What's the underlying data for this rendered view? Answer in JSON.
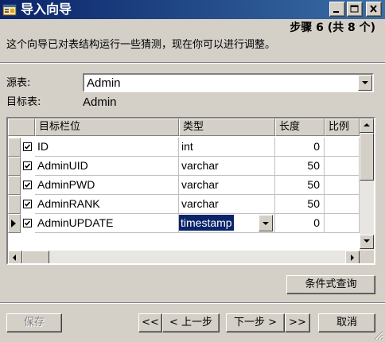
{
  "window": {
    "title": "导入向导",
    "icon": "wizard-app-icon",
    "controls": [
      "minimize-icon",
      "maximize-icon",
      "close-icon"
    ]
  },
  "header": {
    "step": "步骤 6 (共 8 个)",
    "description": "这个向导已对表结构运行一些猜测，现在你可以进行调整。"
  },
  "source": {
    "label": "源表:",
    "value": "Admin"
  },
  "target": {
    "label": "目标表:",
    "value": "Admin"
  },
  "grid": {
    "columns": [
      "目标栏位",
      "类型",
      "长度",
      "比例"
    ],
    "rows": [
      {
        "checked": true,
        "field": "ID",
        "type": "int",
        "length": "0",
        "scale": ""
      },
      {
        "checked": true,
        "field": "AdminUID",
        "type": "varchar",
        "length": "50",
        "scale": ""
      },
      {
        "checked": true,
        "field": "AdminPWD",
        "type": "varchar",
        "length": "50",
        "scale": ""
      },
      {
        "checked": true,
        "field": "AdminRANK",
        "type": "varchar",
        "length": "50",
        "scale": ""
      },
      {
        "checked": true,
        "field": "AdminUPDATE",
        "type": "timestamp",
        "length": "0",
        "scale": "",
        "current": true,
        "editing": true
      }
    ]
  },
  "buttons": {
    "conditional_query": "条件式查询",
    "save": "保存",
    "first": "<<",
    "prev": "< 上一步",
    "next": "下一步 >",
    "last": ">>",
    "cancel": "取消"
  },
  "colors": {
    "title_start": "#0a246a",
    "title_end": "#3a6ea5",
    "selection": "#0a246a",
    "face": "#d4d0c8"
  }
}
